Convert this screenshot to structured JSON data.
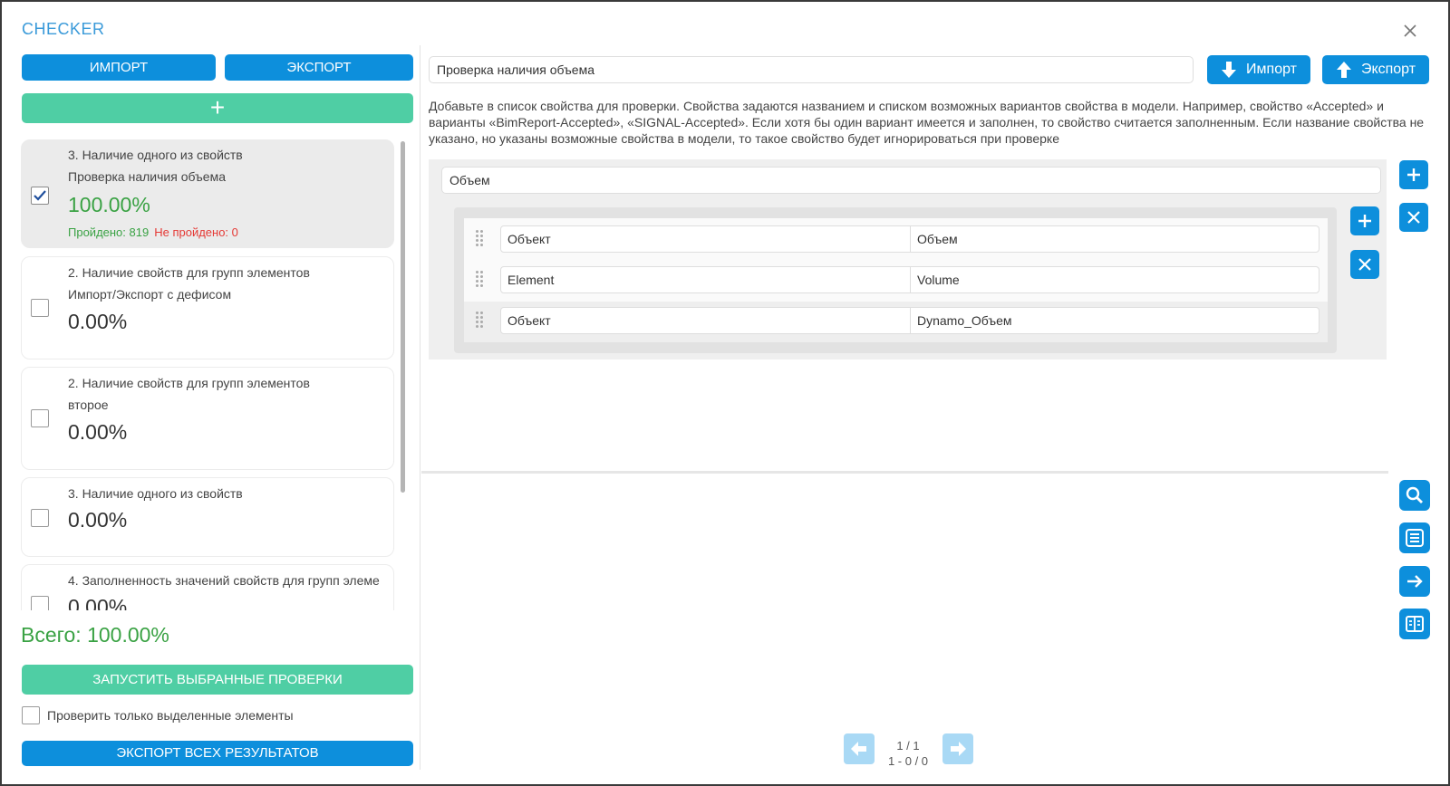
{
  "app": {
    "title": "CHECKER"
  },
  "left": {
    "import_label": "ИМПОРТ",
    "export_label": "ЭКСПОРТ",
    "add_label": "+",
    "checks": [
      {
        "checked": true,
        "line1": "3. Наличие одного из свойств",
        "line2": "Проверка наличия объема",
        "percent": "100.00%",
        "passed": "Пройдено: 819",
        "failed": "Не пройдено: 0"
      },
      {
        "checked": false,
        "line1": "2. Наличие свойств для групп элементов",
        "line2": "Импорт/Экспорт с дефисом",
        "percent": "0.00%"
      },
      {
        "checked": false,
        "line1": "2. Наличие свойств для групп элементов",
        "line2": "второе",
        "percent": "0.00%"
      },
      {
        "checked": false,
        "line1": "3. Наличие одного из свойств",
        "percent": "0.00%"
      },
      {
        "checked": false,
        "line1": "4. Заполненность значений свойств для групп элеме",
        "percent": "0.00%"
      }
    ],
    "total": "Всего: 100.00%",
    "run_label": "ЗАПУСТИТЬ ВЫБРАННЫЕ ПРОВЕРКИ",
    "check_selected_label": "Проверить только выделенные элементы",
    "export_all_label": "ЭКСПОРТ ВСЕХ РЕЗУЛЬТАТОВ"
  },
  "right": {
    "check_name": "Проверка наличия объема",
    "import_label": "Импорт",
    "export_label": "Экспорт",
    "description": "Добавьте в список свойства для проверки. Свойства задаются названием и списком возможных вариантов свойства в модели. Например, свойство «Accepted» и варианты «BimReport-Accepted», «SIGNAL-Accepted». Если хотя бы один вариант имеется и заполнен, то свойство считается заполненным. Если название свойства не указано, но указаны возможные свойства в модели, то такое свойство будет игнорироваться при проверке",
    "property_name": "Объем",
    "variants": [
      {
        "group": "Объект",
        "property": "Объем"
      },
      {
        "group": "Element",
        "property": "Volume"
      },
      {
        "group": "Объект",
        "property": "Dynamo_Объем"
      }
    ]
  },
  "pager": {
    "pages": "1 / 1",
    "range": "1 - 0 / 0"
  },
  "colors": {
    "accent_blue": "#0d8fdc",
    "accent_green": "#4fcea4",
    "pass_green": "#3aa244",
    "fail_red": "#e53935"
  }
}
